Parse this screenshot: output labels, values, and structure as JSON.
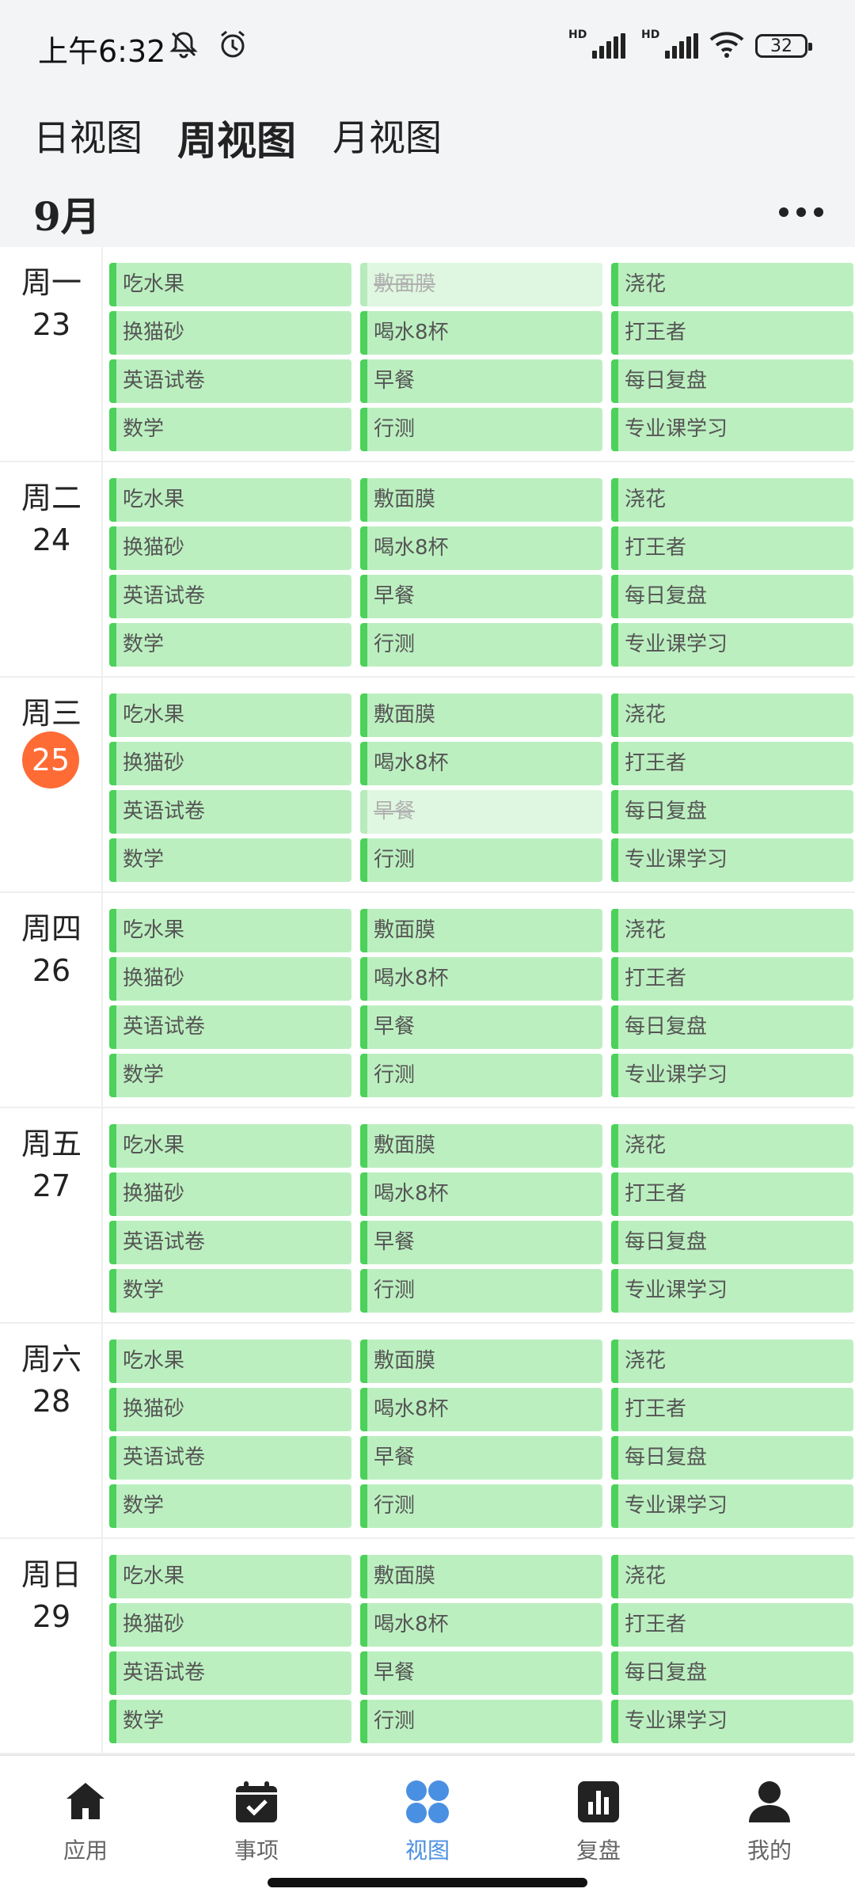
{
  "status_bar": {
    "time": "上午6:32",
    "hd1": "HD",
    "hd2": "HD",
    "battery": "32"
  },
  "tabs": {
    "day": "日视图",
    "week": "周视图",
    "month": "月视图"
  },
  "month_label": "9月",
  "days": [
    {
      "weekday": "周一",
      "date": "23",
      "today": false,
      "tasks": [
        {
          "label": "吃水果",
          "done": false
        },
        {
          "label": "敷面膜",
          "done": true
        },
        {
          "label": "浇花",
          "done": false
        },
        {
          "label": "换猫砂",
          "done": false
        },
        {
          "label": "喝水8杯",
          "done": false
        },
        {
          "label": "打王者",
          "done": false
        },
        {
          "label": "英语试卷",
          "done": false
        },
        {
          "label": "早餐",
          "done": false
        },
        {
          "label": "每日复盘",
          "done": false
        },
        {
          "label": "数学",
          "done": false
        },
        {
          "label": "行测",
          "done": false
        },
        {
          "label": "专业课学习",
          "done": false
        }
      ]
    },
    {
      "weekday": "周二",
      "date": "24",
      "today": false,
      "tasks": [
        {
          "label": "吃水果",
          "done": false
        },
        {
          "label": "敷面膜",
          "done": false
        },
        {
          "label": "浇花",
          "done": false
        },
        {
          "label": "换猫砂",
          "done": false
        },
        {
          "label": "喝水8杯",
          "done": false
        },
        {
          "label": "打王者",
          "done": false
        },
        {
          "label": "英语试卷",
          "done": false
        },
        {
          "label": "早餐",
          "done": false
        },
        {
          "label": "每日复盘",
          "done": false
        },
        {
          "label": "数学",
          "done": false
        },
        {
          "label": "行测",
          "done": false
        },
        {
          "label": "专业课学习",
          "done": false
        }
      ]
    },
    {
      "weekday": "周三",
      "date": "25",
      "today": true,
      "tasks": [
        {
          "label": "吃水果",
          "done": false
        },
        {
          "label": "敷面膜",
          "done": false
        },
        {
          "label": "浇花",
          "done": false
        },
        {
          "label": "换猫砂",
          "done": false
        },
        {
          "label": "喝水8杯",
          "done": false
        },
        {
          "label": "打王者",
          "done": false
        },
        {
          "label": "英语试卷",
          "done": false
        },
        {
          "label": "早餐",
          "done": true
        },
        {
          "label": "每日复盘",
          "done": false
        },
        {
          "label": "数学",
          "done": false
        },
        {
          "label": "行测",
          "done": false
        },
        {
          "label": "专业课学习",
          "done": false
        }
      ]
    },
    {
      "weekday": "周四",
      "date": "26",
      "today": false,
      "tasks": [
        {
          "label": "吃水果",
          "done": false
        },
        {
          "label": "敷面膜",
          "done": false
        },
        {
          "label": "浇花",
          "done": false
        },
        {
          "label": "换猫砂",
          "done": false
        },
        {
          "label": "喝水8杯",
          "done": false
        },
        {
          "label": "打王者",
          "done": false
        },
        {
          "label": "英语试卷",
          "done": false
        },
        {
          "label": "早餐",
          "done": false
        },
        {
          "label": "每日复盘",
          "done": false
        },
        {
          "label": "数学",
          "done": false
        },
        {
          "label": "行测",
          "done": false
        },
        {
          "label": "专业课学习",
          "done": false
        }
      ]
    },
    {
      "weekday": "周五",
      "date": "27",
      "today": false,
      "tasks": [
        {
          "label": "吃水果",
          "done": false
        },
        {
          "label": "敷面膜",
          "done": false
        },
        {
          "label": "浇花",
          "done": false
        },
        {
          "label": "换猫砂",
          "done": false
        },
        {
          "label": "喝水8杯",
          "done": false
        },
        {
          "label": "打王者",
          "done": false
        },
        {
          "label": "英语试卷",
          "done": false
        },
        {
          "label": "早餐",
          "done": false
        },
        {
          "label": "每日复盘",
          "done": false
        },
        {
          "label": "数学",
          "done": false
        },
        {
          "label": "行测",
          "done": false
        },
        {
          "label": "专业课学习",
          "done": false
        }
      ]
    },
    {
      "weekday": "周六",
      "date": "28",
      "today": false,
      "tasks": [
        {
          "label": "吃水果",
          "done": false
        },
        {
          "label": "敷面膜",
          "done": false
        },
        {
          "label": "浇花",
          "done": false
        },
        {
          "label": "换猫砂",
          "done": false
        },
        {
          "label": "喝水8杯",
          "done": false
        },
        {
          "label": "打王者",
          "done": false
        },
        {
          "label": "英语试卷",
          "done": false
        },
        {
          "label": "早餐",
          "done": false
        },
        {
          "label": "每日复盘",
          "done": false
        },
        {
          "label": "数学",
          "done": false
        },
        {
          "label": "行测",
          "done": false
        },
        {
          "label": "专业课学习",
          "done": false
        }
      ]
    },
    {
      "weekday": "周日",
      "date": "29",
      "today": false,
      "tasks": [
        {
          "label": "吃水果",
          "done": false
        },
        {
          "label": "敷面膜",
          "done": false
        },
        {
          "label": "浇花",
          "done": false
        },
        {
          "label": "换猫砂",
          "done": false
        },
        {
          "label": "喝水8杯",
          "done": false
        },
        {
          "label": "打王者",
          "done": false
        },
        {
          "label": "英语试卷",
          "done": false
        },
        {
          "label": "早餐",
          "done": false
        },
        {
          "label": "每日复盘",
          "done": false
        },
        {
          "label": "数学",
          "done": false
        },
        {
          "label": "行测",
          "done": false
        },
        {
          "label": "专业课学习",
          "done": false
        }
      ]
    }
  ],
  "bottom_nav": [
    {
      "label": "应用",
      "icon": "home-icon",
      "active": false
    },
    {
      "label": "事项",
      "icon": "calendar-check-icon",
      "active": false
    },
    {
      "label": "视图",
      "icon": "grid-view-icon",
      "active": true
    },
    {
      "label": "复盘",
      "icon": "bar-chart-icon",
      "active": false
    },
    {
      "label": "我的",
      "icon": "user-icon",
      "active": false
    }
  ],
  "colors": {
    "task_bg": "#bcefc0",
    "task_accent": "#4cd15a",
    "task_done_bg": "#dff7e0",
    "today_badge": "#ff6b35",
    "nav_active": "#4a90e2"
  }
}
